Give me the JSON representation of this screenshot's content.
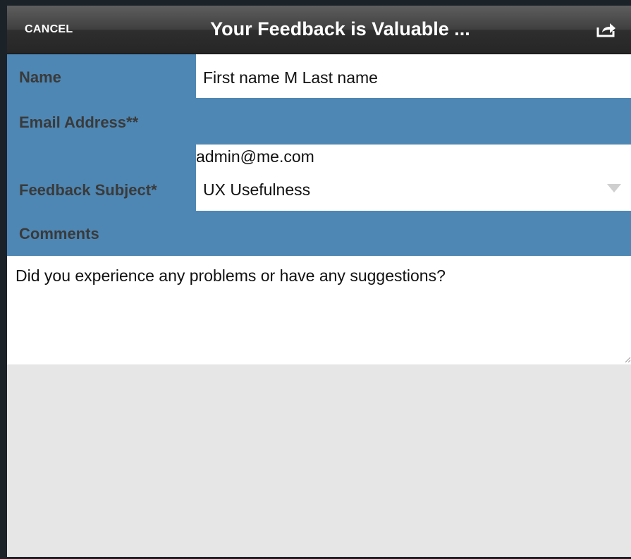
{
  "navbar": {
    "cancel_label": "CANCEL",
    "title": "Your Feedback is Valuable ...",
    "share_icon": "share-icon"
  },
  "form": {
    "name_label": "Name",
    "name_value": "First name M Last name",
    "email_label": "Email Address**",
    "email_value": "admin@me.com",
    "subject_label": "Feedback Subject*",
    "subject_value": "UX Usefulness",
    "comments_label": "Comments",
    "comments_placeholder": "Did you experience any problems or have any suggestions?"
  },
  "colors": {
    "label_band": "#4e87b4",
    "navbar": "#3f3f3f",
    "background": "#e6e6e6"
  }
}
